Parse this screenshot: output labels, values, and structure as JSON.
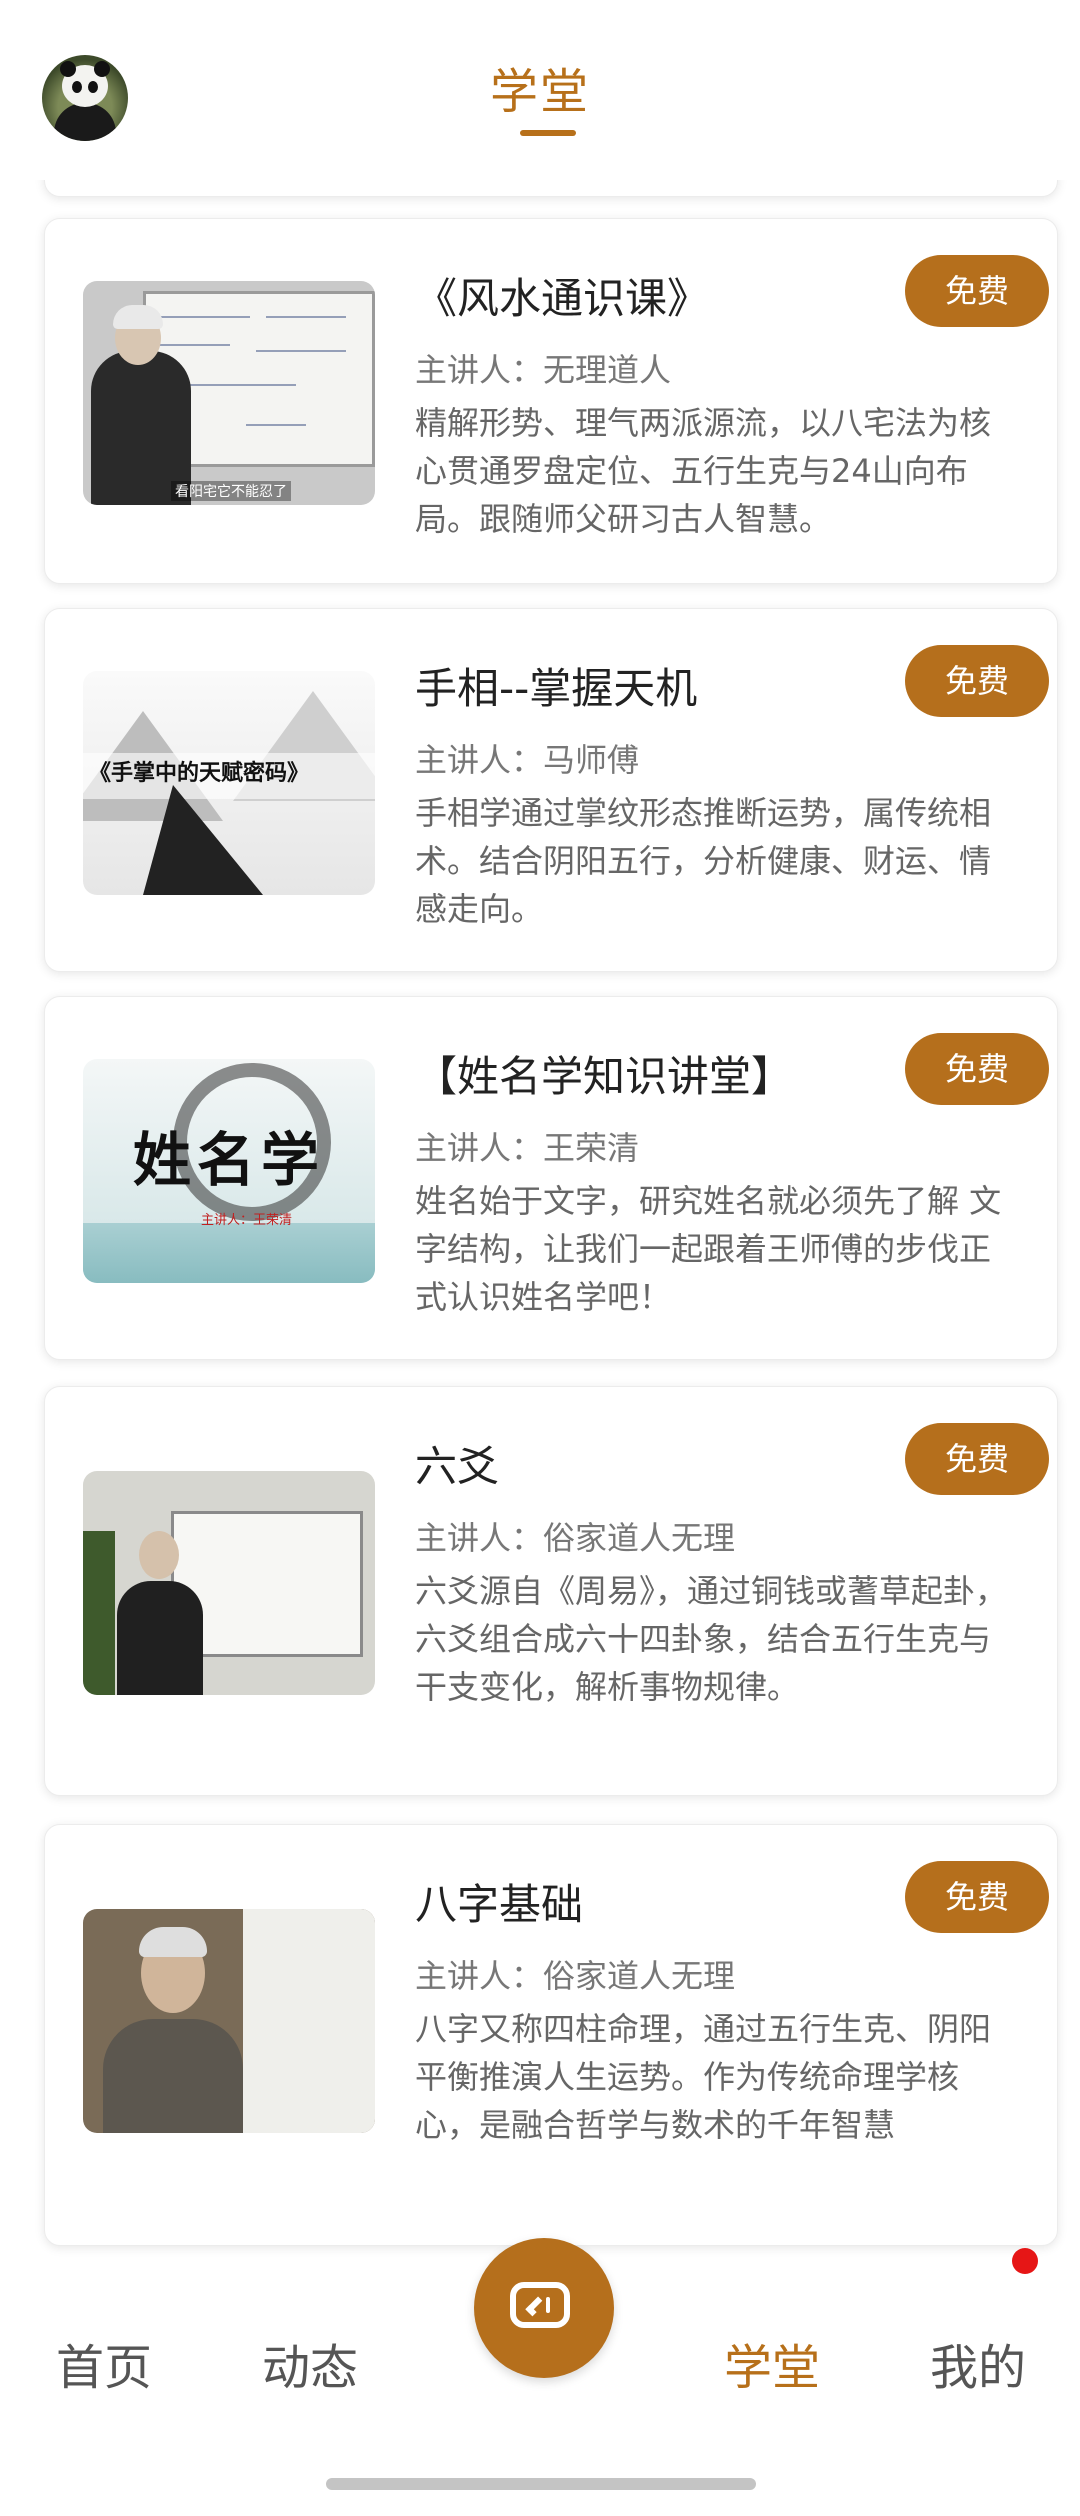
{
  "header": {
    "title": "学堂"
  },
  "courses": [
    {
      "title": "《风水通识课》",
      "teacher": "主讲人：无理道人",
      "desc": "精解形势、理气两派源流，以八宅法为核心贯通罗盘定位、五行生克与24山向布局。跟随师父研习古人智慧。",
      "badge": "免费",
      "thumb_caption": "看阳宅它不能忍了"
    },
    {
      "title": "手相--掌握天机",
      "teacher": "主讲人：马师傅",
      "desc": "手相学通过掌纹形态推断运势，属传统相术。结合阴阳五行，分析健康、财运、情感走向。",
      "badge": "免费",
      "thumb_caption": "《手掌中的天赋密码》"
    },
    {
      "title": "【姓名学知识讲堂】",
      "teacher": "主讲人：王荣清",
      "desc": "姓名始于文字，研究姓名就必须先了解 文字结构，让我们一起跟着王师傅的步伐正式认识姓名学吧！",
      "badge": "免费",
      "thumb_caption": "姓名学",
      "thumb_subcaption": "主讲人：王荣清"
    },
    {
      "title": "六爻",
      "teacher": "主讲人：俗家道人无理",
      "desc": "六爻源自《周易》，通过铜钱或蓍草起卦，六爻组合成六十四卦象，结合五行生克与干支变化，解析事物规律。",
      "badge": "免费"
    },
    {
      "title": "八字基础",
      "teacher": "主讲人：俗家道人无理",
      "desc": "八字又称四柱命理，通过五行生克、阴阳平衡推演人生运势。作为传统命理学核心，是融合哲学与数术的千年智慧",
      "badge": "免费"
    }
  ],
  "nav": {
    "home": "首页",
    "feed": "动态",
    "school": "学堂",
    "mine": "我的",
    "active": "学堂",
    "center_icon": "video-camera-icon",
    "accent_color": "#b56f1c",
    "badge_color": "#e61616"
  }
}
